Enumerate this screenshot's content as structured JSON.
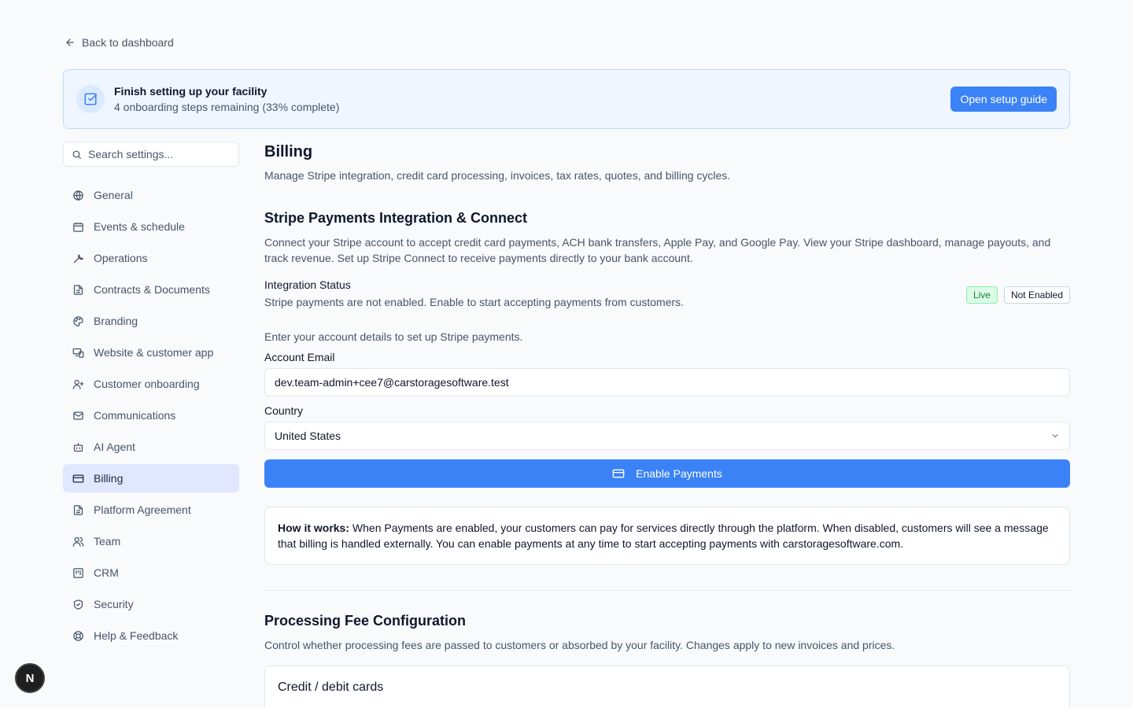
{
  "back_link": {
    "label": "Back to dashboard"
  },
  "setup_banner": {
    "title": "Finish setting up your facility",
    "subtitle": "4 onboarding steps remaining (33% complete)",
    "button_label": "Open setup guide"
  },
  "sidebar": {
    "search_placeholder": "Search settings...",
    "items": [
      {
        "label": "General",
        "icon": "globe-icon",
        "active": false
      },
      {
        "label": "Events & schedule",
        "icon": "calendar-icon",
        "active": false
      },
      {
        "label": "Operations",
        "icon": "wrench-icon",
        "active": false
      },
      {
        "label": "Contracts & Documents",
        "icon": "document-icon",
        "active": false
      },
      {
        "label": "Branding",
        "icon": "palette-icon",
        "active": false
      },
      {
        "label": "Website & customer app",
        "icon": "devices-icon",
        "active": false
      },
      {
        "label": "Customer onboarding",
        "icon": "user-plus-icon",
        "active": false
      },
      {
        "label": "Communications",
        "icon": "mail-icon",
        "active": false
      },
      {
        "label": "AI Agent",
        "icon": "bot-icon",
        "active": false
      },
      {
        "label": "Billing",
        "icon": "credit-card-icon",
        "active": true
      },
      {
        "label": "Platform Agreement",
        "icon": "document-icon",
        "active": false
      },
      {
        "label": "Team",
        "icon": "users-icon",
        "active": false
      },
      {
        "label": "CRM",
        "icon": "kanban-icon",
        "active": false
      },
      {
        "label": "Security",
        "icon": "shield-icon",
        "active": false
      },
      {
        "label": "Help & Feedback",
        "icon": "lifebuoy-icon",
        "active": false
      }
    ]
  },
  "main": {
    "title": "Billing",
    "subtitle": "Manage Stripe integration, credit card processing, invoices, tax rates, quotes, and billing cycles.",
    "stripe": {
      "heading": "Stripe Payments Integration & Connect",
      "description": "Connect your Stripe account to accept credit card payments, ACH bank transfers, Apple Pay, and Google Pay. View your Stripe dashboard, manage payouts, and track revenue. Set up Stripe Connect to receive payments directly to your bank account.",
      "status_label": "Integration Status",
      "status_description": "Stripe payments are not enabled. Enable to start accepting payments from customers.",
      "badge_live": "Live",
      "badge_status": "Not Enabled",
      "hint": "Enter your account details to set up Stripe payments.",
      "email_label": "Account Email",
      "email_value": "dev.team-admin+cee7@carstoragesoftware.test",
      "country_label": "Country",
      "country_value": "United States",
      "enable_button": "Enable Payments",
      "info_bold": "How it works:",
      "info_text": " When Payments are enabled, your customers can pay for services directly through the platform. When disabled, customers will see a message that billing is handled externally. You can enable payments at any time to start accepting payments with carstoragesoftware.com."
    },
    "fees": {
      "heading": "Processing Fee Configuration",
      "description": "Control whether processing fees are passed to customers or absorbed by your facility. Changes apply to new invoices and prices.",
      "card_title": "Credit / debit cards"
    }
  },
  "fab": {
    "label": "N"
  },
  "colors": {
    "accent": "#3b82f6",
    "active_nav": "#e0e7ff",
    "live_badge": "#dcfce7"
  }
}
